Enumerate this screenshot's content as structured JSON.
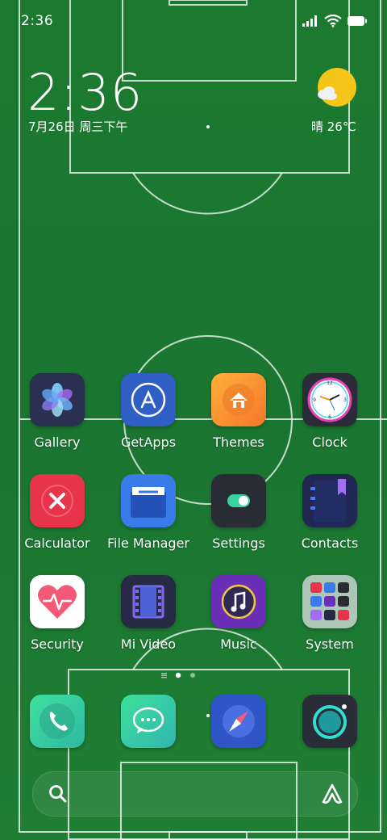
{
  "status_bar": {
    "time": "2:36",
    "icons": [
      "signal-icon",
      "wifi-icon",
      "battery-icon"
    ]
  },
  "clock_widget": {
    "time": "2:36",
    "date": "7月26日 周三下午"
  },
  "weather_widget": {
    "condition_icon": "sun-cloud-icon",
    "text": "晴 26℃"
  },
  "apps": [
    {
      "label": "Gallery",
      "icon": "gallery-icon"
    },
    {
      "label": "GetApps",
      "icon": "getapps-icon"
    },
    {
      "label": "Themes",
      "icon": "themes-icon"
    },
    {
      "label": "Clock",
      "icon": "clock-icon"
    },
    {
      "label": "Calculator",
      "icon": "calculator-icon"
    },
    {
      "label": "File Manager",
      "icon": "file-manager-icon"
    },
    {
      "label": "Settings",
      "icon": "settings-icon"
    },
    {
      "label": "Contacts",
      "icon": "contacts-icon"
    },
    {
      "label": "Security",
      "icon": "security-icon"
    },
    {
      "label": "Mi Video",
      "icon": "mi-video-icon"
    },
    {
      "label": "Music",
      "icon": "music-icon"
    },
    {
      "label": "System",
      "icon": "folder-icon"
    }
  ],
  "dock": [
    {
      "icon": "phone-icon"
    },
    {
      "icon": "messages-icon"
    },
    {
      "icon": "browser-icon"
    },
    {
      "icon": "camera-icon"
    }
  ],
  "page_indicator": {
    "pages": 3,
    "current_page": 2
  },
  "colors": {
    "pitch": "#1e7a32",
    "sun": "#f5c518",
    "accent_blue": "#3a6fd8"
  }
}
